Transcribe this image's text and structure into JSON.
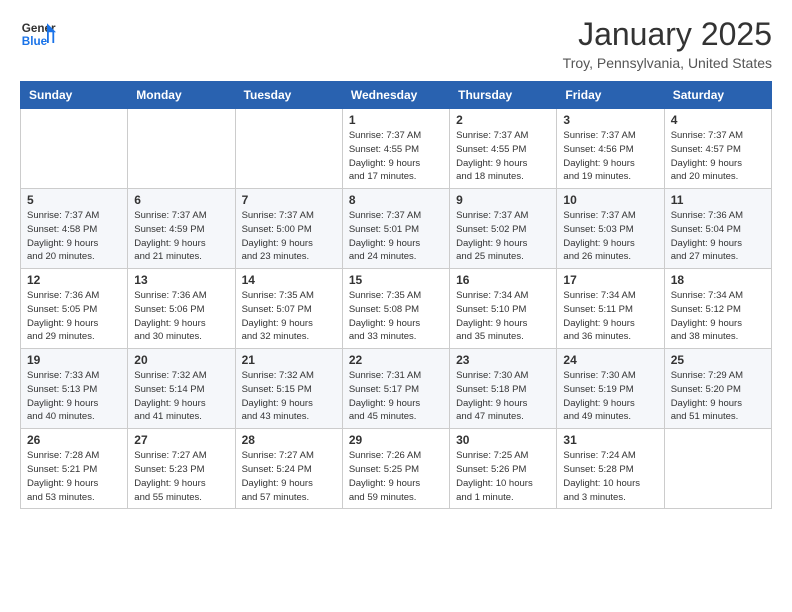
{
  "header": {
    "logo_line1": "General",
    "logo_line2": "Blue",
    "month": "January 2025",
    "location": "Troy, Pennsylvania, United States"
  },
  "weekdays": [
    "Sunday",
    "Monday",
    "Tuesday",
    "Wednesday",
    "Thursday",
    "Friday",
    "Saturday"
  ],
  "weeks": [
    [
      {
        "day": "",
        "info": ""
      },
      {
        "day": "",
        "info": ""
      },
      {
        "day": "",
        "info": ""
      },
      {
        "day": "1",
        "info": "Sunrise: 7:37 AM\nSunset: 4:55 PM\nDaylight: 9 hours\nand 17 minutes."
      },
      {
        "day": "2",
        "info": "Sunrise: 7:37 AM\nSunset: 4:55 PM\nDaylight: 9 hours\nand 18 minutes."
      },
      {
        "day": "3",
        "info": "Sunrise: 7:37 AM\nSunset: 4:56 PM\nDaylight: 9 hours\nand 19 minutes."
      },
      {
        "day": "4",
        "info": "Sunrise: 7:37 AM\nSunset: 4:57 PM\nDaylight: 9 hours\nand 20 minutes."
      }
    ],
    [
      {
        "day": "5",
        "info": "Sunrise: 7:37 AM\nSunset: 4:58 PM\nDaylight: 9 hours\nand 20 minutes."
      },
      {
        "day": "6",
        "info": "Sunrise: 7:37 AM\nSunset: 4:59 PM\nDaylight: 9 hours\nand 21 minutes."
      },
      {
        "day": "7",
        "info": "Sunrise: 7:37 AM\nSunset: 5:00 PM\nDaylight: 9 hours\nand 23 minutes."
      },
      {
        "day": "8",
        "info": "Sunrise: 7:37 AM\nSunset: 5:01 PM\nDaylight: 9 hours\nand 24 minutes."
      },
      {
        "day": "9",
        "info": "Sunrise: 7:37 AM\nSunset: 5:02 PM\nDaylight: 9 hours\nand 25 minutes."
      },
      {
        "day": "10",
        "info": "Sunrise: 7:37 AM\nSunset: 5:03 PM\nDaylight: 9 hours\nand 26 minutes."
      },
      {
        "day": "11",
        "info": "Sunrise: 7:36 AM\nSunset: 5:04 PM\nDaylight: 9 hours\nand 27 minutes."
      }
    ],
    [
      {
        "day": "12",
        "info": "Sunrise: 7:36 AM\nSunset: 5:05 PM\nDaylight: 9 hours\nand 29 minutes."
      },
      {
        "day": "13",
        "info": "Sunrise: 7:36 AM\nSunset: 5:06 PM\nDaylight: 9 hours\nand 30 minutes."
      },
      {
        "day": "14",
        "info": "Sunrise: 7:35 AM\nSunset: 5:07 PM\nDaylight: 9 hours\nand 32 minutes."
      },
      {
        "day": "15",
        "info": "Sunrise: 7:35 AM\nSunset: 5:08 PM\nDaylight: 9 hours\nand 33 minutes."
      },
      {
        "day": "16",
        "info": "Sunrise: 7:34 AM\nSunset: 5:10 PM\nDaylight: 9 hours\nand 35 minutes."
      },
      {
        "day": "17",
        "info": "Sunrise: 7:34 AM\nSunset: 5:11 PM\nDaylight: 9 hours\nand 36 minutes."
      },
      {
        "day": "18",
        "info": "Sunrise: 7:34 AM\nSunset: 5:12 PM\nDaylight: 9 hours\nand 38 minutes."
      }
    ],
    [
      {
        "day": "19",
        "info": "Sunrise: 7:33 AM\nSunset: 5:13 PM\nDaylight: 9 hours\nand 40 minutes."
      },
      {
        "day": "20",
        "info": "Sunrise: 7:32 AM\nSunset: 5:14 PM\nDaylight: 9 hours\nand 41 minutes."
      },
      {
        "day": "21",
        "info": "Sunrise: 7:32 AM\nSunset: 5:15 PM\nDaylight: 9 hours\nand 43 minutes."
      },
      {
        "day": "22",
        "info": "Sunrise: 7:31 AM\nSunset: 5:17 PM\nDaylight: 9 hours\nand 45 minutes."
      },
      {
        "day": "23",
        "info": "Sunrise: 7:30 AM\nSunset: 5:18 PM\nDaylight: 9 hours\nand 47 minutes."
      },
      {
        "day": "24",
        "info": "Sunrise: 7:30 AM\nSunset: 5:19 PM\nDaylight: 9 hours\nand 49 minutes."
      },
      {
        "day": "25",
        "info": "Sunrise: 7:29 AM\nSunset: 5:20 PM\nDaylight: 9 hours\nand 51 minutes."
      }
    ],
    [
      {
        "day": "26",
        "info": "Sunrise: 7:28 AM\nSunset: 5:21 PM\nDaylight: 9 hours\nand 53 minutes."
      },
      {
        "day": "27",
        "info": "Sunrise: 7:27 AM\nSunset: 5:23 PM\nDaylight: 9 hours\nand 55 minutes."
      },
      {
        "day": "28",
        "info": "Sunrise: 7:27 AM\nSunset: 5:24 PM\nDaylight: 9 hours\nand 57 minutes."
      },
      {
        "day": "29",
        "info": "Sunrise: 7:26 AM\nSunset: 5:25 PM\nDaylight: 9 hours\nand 59 minutes."
      },
      {
        "day": "30",
        "info": "Sunrise: 7:25 AM\nSunset: 5:26 PM\nDaylight: 10 hours\nand 1 minute."
      },
      {
        "day": "31",
        "info": "Sunrise: 7:24 AM\nSunset: 5:28 PM\nDaylight: 10 hours\nand 3 minutes."
      },
      {
        "day": "",
        "info": ""
      }
    ]
  ]
}
